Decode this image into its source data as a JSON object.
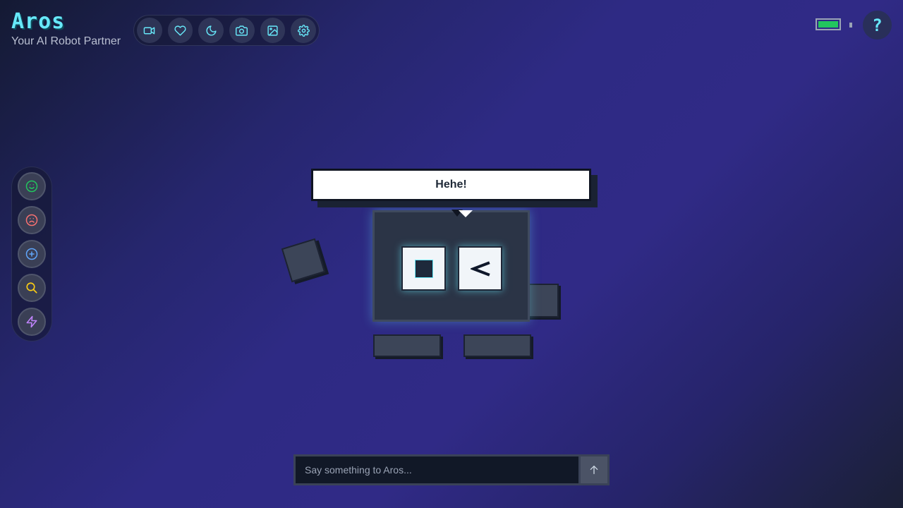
{
  "app": {
    "title": "Aros",
    "subtitle": "Your AI Robot Partner"
  },
  "toolbar": {
    "buttons": [
      {
        "name": "video",
        "icon": "video-camera-icon"
      },
      {
        "name": "favorite",
        "icon": "heart-icon"
      },
      {
        "name": "sleep",
        "icon": "moon-icon"
      },
      {
        "name": "photo",
        "icon": "camera-icon"
      },
      {
        "name": "gallery",
        "icon": "image-icon"
      },
      {
        "name": "settings",
        "icon": "gear-icon"
      }
    ],
    "icon_color": "#67e8f9"
  },
  "status": {
    "battery_level": 1.0,
    "battery_color": "#22c55e",
    "help_icon": "question-mark-icon",
    "help_label": "?"
  },
  "emote_bar": {
    "buttons": [
      {
        "name": "happy",
        "icon": "smile-icon",
        "color": "#22c55e"
      },
      {
        "name": "sad",
        "icon": "frown-icon",
        "color": "#f87171"
      },
      {
        "name": "add",
        "icon": "plus-circle-icon",
        "color": "#60a5fa"
      },
      {
        "name": "search",
        "icon": "search-icon",
        "color": "#facc15"
      },
      {
        "name": "energy",
        "icon": "lightning-icon",
        "color": "#c084fc"
      }
    ]
  },
  "robot": {
    "speech": "Hehe!",
    "left_eye": "square-pupil",
    "right_eye": "squint-chevron",
    "right_eye_glyph": "<"
  },
  "chat": {
    "placeholder": "Say something to Aros...",
    "value": "",
    "send_icon": "arrow-up-icon"
  }
}
